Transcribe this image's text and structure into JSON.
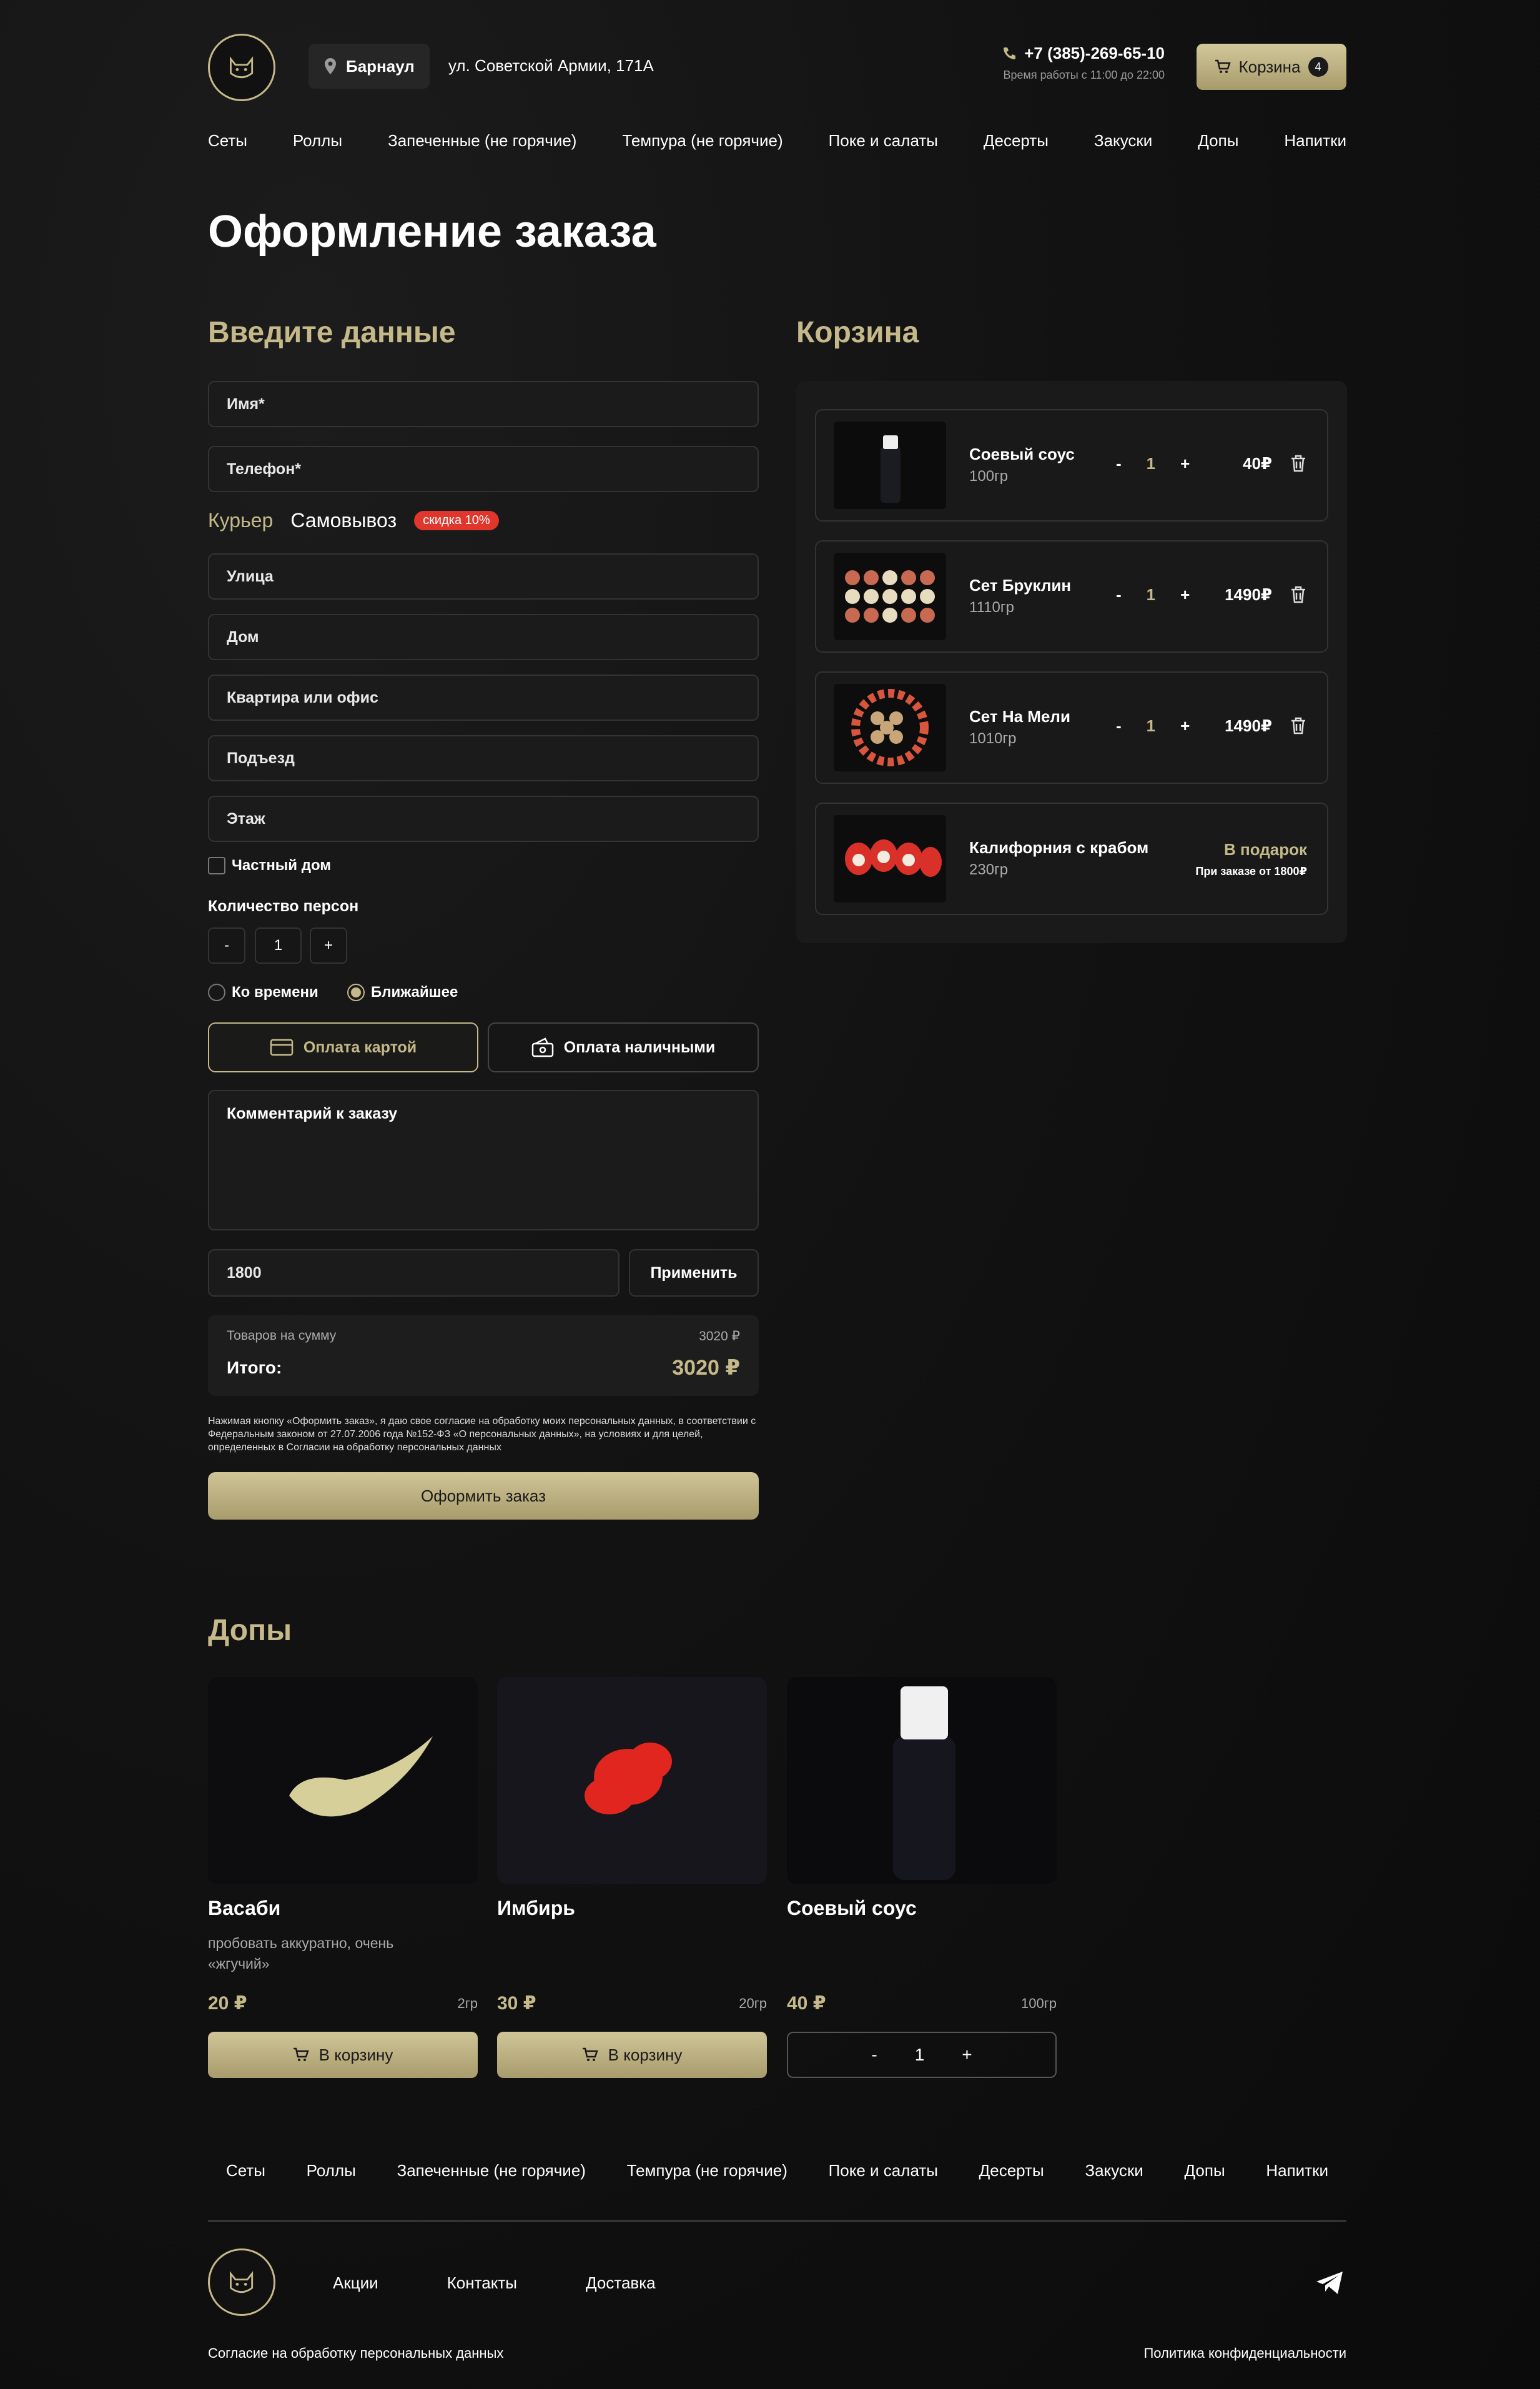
{
  "header": {
    "city": "Барнаул",
    "address": "ул. Советской Армии, 171А",
    "phone": "+7 (385)-269-65-10",
    "hours": "Время работы с 11:00 до 22:00",
    "cart_label": "Корзина",
    "cart_count": "4"
  },
  "nav": [
    "Сеты",
    "Роллы",
    "Запеченные (не горячие)",
    "Темпура (не горячие)",
    "Поке и салаты",
    "Десерты",
    "Закуски",
    "Допы",
    "Напитки"
  ],
  "page_title": "Оформление заказа",
  "form": {
    "heading": "Введите данные",
    "name_placeholder": "Имя*",
    "phone_placeholder": "Телефон*",
    "tab_courier": "Курьер",
    "tab_pickup": "Самовывоз",
    "discount_badge": "скидка 10%",
    "street": "Улица",
    "house": "Дом",
    "apartment": "Квартира или офис",
    "entrance": "Подъезд",
    "floor": "Этаж",
    "private_house": "Частный дом",
    "persons_label": "Количество персон",
    "persons_minus": "-",
    "persons_value": "1",
    "persons_plus": "+",
    "time_option_1": "Ко времени",
    "time_option_2": "Ближайшее",
    "pay_card": "Оплата картой",
    "pay_cash": "Оплата наличными",
    "comment_placeholder": "Комментарий к заказу",
    "promo_value": "1800",
    "apply_label": "Применить",
    "subtotal_label": "Товаров на сумму",
    "subtotal_value": "3020 ₽",
    "total_label": "Итого:",
    "total_value": "3020 ₽",
    "legal": "Нажимая кнопку «Оформить заказ», я даю свое согласие на обработку моих персональных данных, в соответствии с Федеральным законом от 27.07.2006 года №152-ФЗ «О персональных данных», на условиях и для целей, определенных в Согласии на обработку персональных данных",
    "submit_label": "Оформить заказ"
  },
  "cart": {
    "heading": "Корзина",
    "items": [
      {
        "name": "Соевый соус",
        "weight": "100гр",
        "qty": "1",
        "price": "40₽",
        "minus": "-",
        "plus": "+"
      },
      {
        "name": "Сет Бруклин",
        "weight": "1110гр",
        "qty": "1",
        "price": "1490₽",
        "minus": "-",
        "plus": "+"
      },
      {
        "name": "Сет На Мели",
        "weight": "1010гр",
        "qty": "1",
        "price": "1490₽",
        "minus": "-",
        "plus": "+"
      },
      {
        "name": "Калифорния с крабом",
        "weight": "230гр",
        "gift": "В подарок",
        "gift_note": "При заказе от 1800₽"
      }
    ]
  },
  "extras": {
    "heading": "Допы",
    "products": [
      {
        "name": "Васаби",
        "desc": "пробовать аккуратно, очень «жгучий»",
        "price": "20 ₽",
        "weight": "2гр",
        "button": "В корзину"
      },
      {
        "name": "Имбирь",
        "desc": "",
        "price": "30 ₽",
        "weight": "20гр",
        "button": "В корзину"
      },
      {
        "name": "Соевый соус",
        "desc": "",
        "price": "40 ₽",
        "weight": "100гр",
        "stepper_minus": "-",
        "stepper_value": "1",
        "stepper_plus": "+"
      }
    ]
  },
  "footer": {
    "nav": [
      "Сеты",
      "Роллы",
      "Запеченные (не горячие)",
      "Темпура (не горячие)",
      "Поке и салаты",
      "Десерты",
      "Закуски",
      "Допы",
      "Напитки"
    ],
    "links": [
      "Акции",
      "Контакты",
      "Доставка"
    ],
    "consent": "Согласие на обработку персональных данных",
    "privacy": "Политика конфиденциальности"
  },
  "colors": {
    "accent": "#c5b98a",
    "badge": "#e0362c",
    "background": "#101010"
  }
}
